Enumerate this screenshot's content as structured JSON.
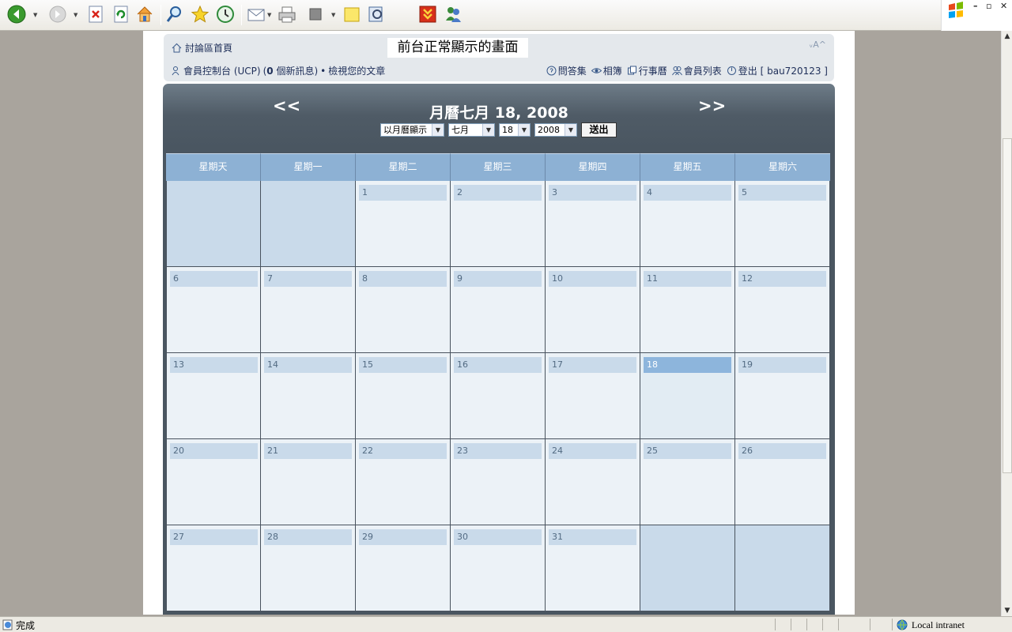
{
  "toolbar": {
    "icons": [
      "back-icon",
      "forward-icon",
      "stop-icon",
      "refresh-icon",
      "home-icon",
      "search-icon",
      "favorites-icon",
      "history-icon",
      "mail-icon",
      "print-icon",
      "edit-icon",
      "discuss-icon",
      "research-icon",
      "flashget-icon",
      "messenger-icon"
    ]
  },
  "header": {
    "home_link": "討論區首頁",
    "font_size_control": "ᵥA^",
    "overlay_caption": "前台正常顯示的畫面",
    "ucp_link": "會員控制台 (UCP)",
    "messages_prefix": "(",
    "messages_count": "0",
    "messages_suffix": "個新訊息)",
    "bullet": "•",
    "view_posts_link": "檢視您的文章",
    "faq_link": "問答集",
    "album_link": "相簿",
    "calendar_link": "行事曆",
    "memberlist_link": "會員列表",
    "logout_link": "登出 [ bau720123 ]"
  },
  "calendar": {
    "prev": "<<",
    "next": ">>",
    "title": "月曆七月 18, 2008",
    "view_select": "以月曆顯示",
    "month_select": "七月",
    "day_select": "18",
    "year_select": "2008",
    "submit_label": "送出",
    "weekdays": [
      "星期天",
      "星期一",
      "星期二",
      "星期三",
      "星期四",
      "星期五",
      "星期六"
    ],
    "today": "18",
    "weeks": [
      [
        "",
        "",
        "1",
        "2",
        "3",
        "4",
        "5"
      ],
      [
        "6",
        "7",
        "8",
        "9",
        "10",
        "11",
        "12"
      ],
      [
        "13",
        "14",
        "15",
        "16",
        "17",
        "18",
        "19"
      ],
      [
        "20",
        "21",
        "22",
        "23",
        "24",
        "25",
        "26"
      ],
      [
        "27",
        "28",
        "29",
        "30",
        "31",
        "",
        ""
      ]
    ]
  },
  "statusbar": {
    "status": "完成",
    "zone": "Local intranet"
  }
}
